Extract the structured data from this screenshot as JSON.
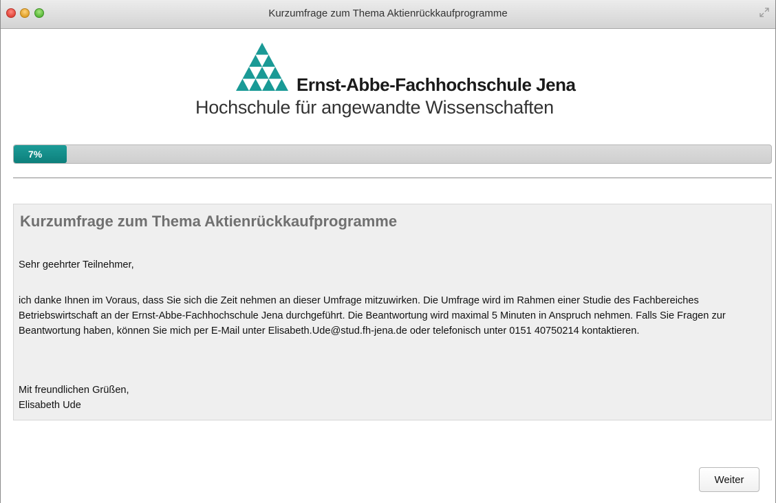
{
  "window": {
    "title": "Kurzumfrage zum Thema Aktienrückkaufprogramme"
  },
  "logo": {
    "name": "Ernst-Abbe-Fachhochschule Jena",
    "subtitle": "Hochschule für angewandte Wissenschaften",
    "color": "#1a9a96"
  },
  "progress": {
    "value": 0.07,
    "label": "7%",
    "color": "#0d7f7b"
  },
  "survey": {
    "title": "Kurzumfrage zum Thema Aktienrückkaufprogramme",
    "greeting": "Sehr geehrter Teilnehmer,",
    "body": "ich danke Ihnen im Voraus, dass Sie sich die Zeit nehmen an dieser Umfrage mitzuwirken. Die Umfrage wird im Rahmen einer Studie des Fachbereiches Betriebswirtschaft an der Ernst-Abbe-Fachhochschule Jena durchgeführt. Die Beantwortung wird maximal 5 Minuten in Anspruch nehmen. Falls Sie Fragen zur Beantwortung haben, können Sie mich per E-Mail unter Elisabeth.Ude@stud.fh-jena.de oder telefonisch unter 0151 40750214 kontaktieren.",
    "closing": "Mit freundlichen Grüßen,",
    "signature": "Elisabeth Ude"
  },
  "buttons": {
    "next_label": "Weiter"
  },
  "icons": {
    "close": "close-icon",
    "minimize": "minimize-icon",
    "zoom": "zoom-icon",
    "fullscreen": "fullscreen-icon",
    "logo": "logo-triangle-icon"
  }
}
